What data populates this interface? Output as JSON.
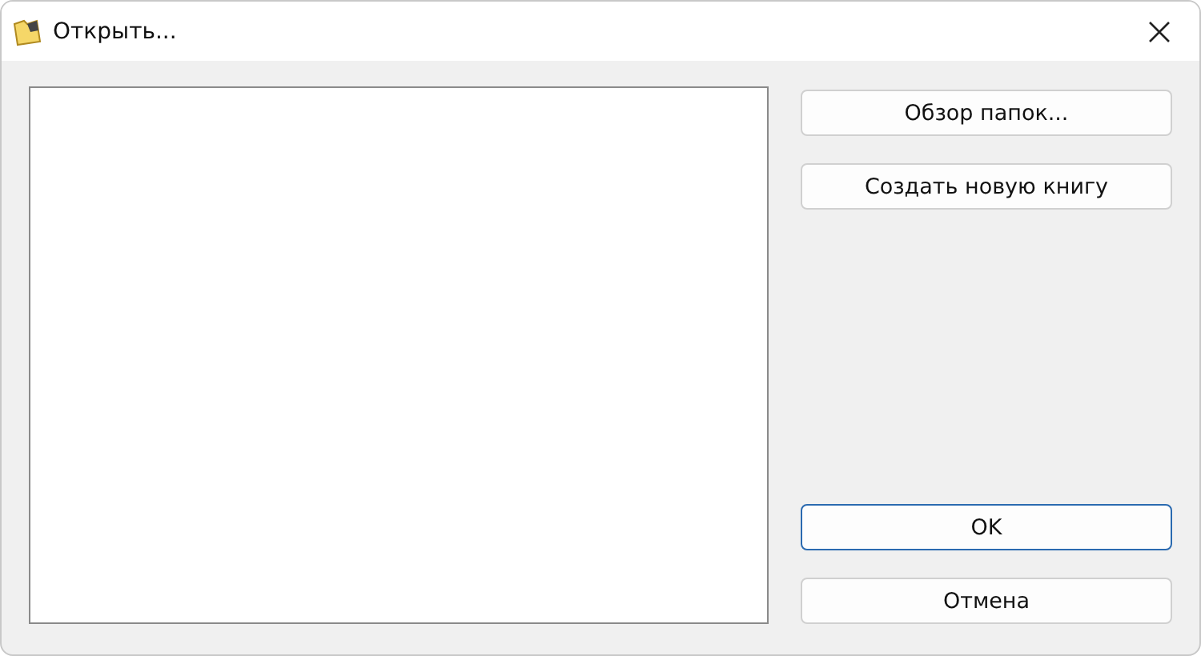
{
  "window": {
    "title": "Открыть..."
  },
  "top_buttons": [
    {
      "label": "Обзор папок...",
      "default": false
    },
    {
      "label": "Создать новую книгу",
      "default": false
    }
  ],
  "bottom_buttons": [
    {
      "label": "OK",
      "default": true
    },
    {
      "label": "Отмена",
      "default": false
    }
  ]
}
